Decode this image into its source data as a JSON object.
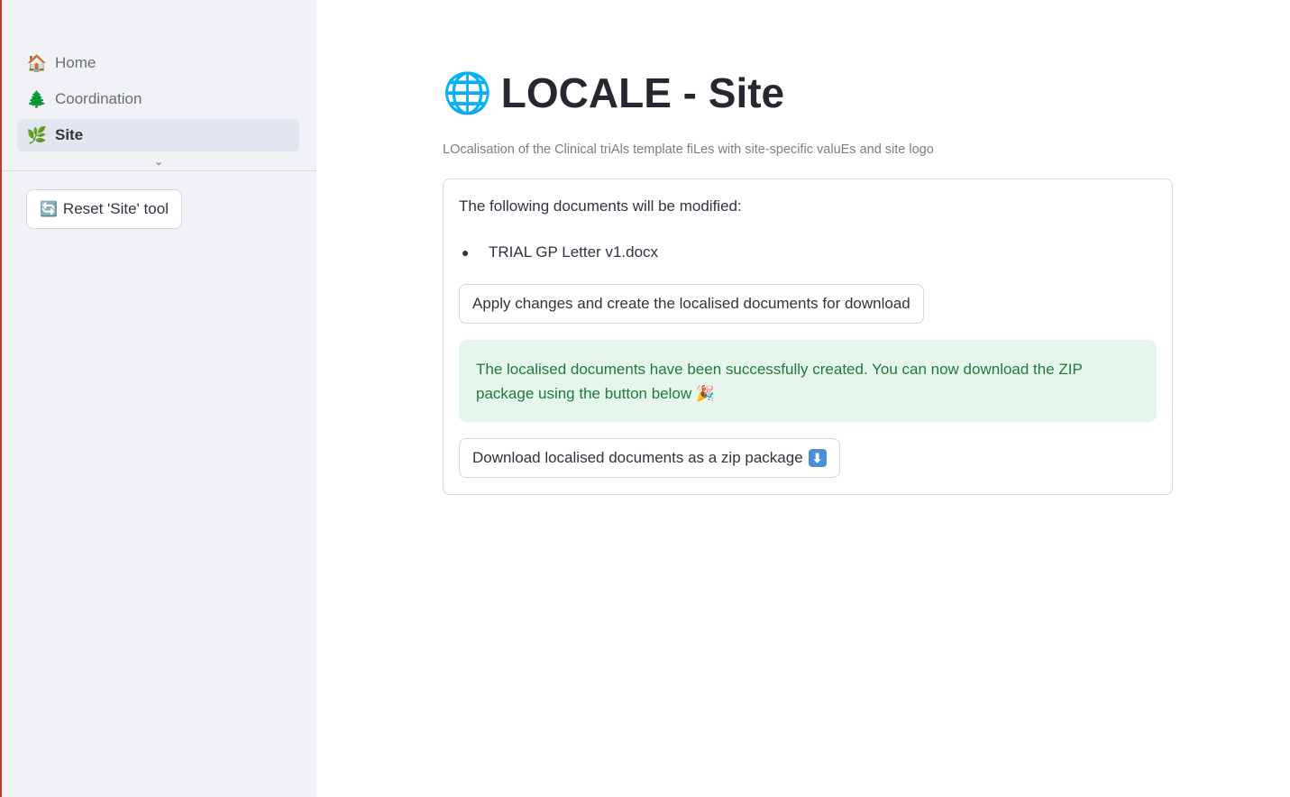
{
  "sidebar": {
    "nav": [
      {
        "icon": "🏠",
        "label": "Home",
        "active": false
      },
      {
        "icon": "🌲",
        "label": "Coordination",
        "active": false
      },
      {
        "icon": "🌿",
        "label": "Site",
        "active": true
      }
    ],
    "chevron_icon": "chevron-down-icon",
    "reset_button": {
      "icon": "🔄",
      "label": "Reset 'Site' tool"
    }
  },
  "main": {
    "title_icon": "🌐",
    "title": "LOCALE - Site",
    "subtitle": "LOcalisation of the Clinical triAls template fiLes with site-specific valuEs and site logo",
    "card": {
      "heading": "The following documents will be modified:",
      "documents": [
        "TRIAL GP Letter v1.docx"
      ],
      "apply_button": "Apply changes and create the localised documents for download",
      "success_message": "The localised documents have been successfully created. You can now download the ZIP package using the button below 🎉",
      "download_button": "Download localised documents as a zip package",
      "download_icon": "⬇"
    }
  },
  "colors": {
    "sidebar_bg": "#f0f2f6",
    "success_bg": "#e7f6ec",
    "success_text": "#1f7a3d",
    "left_edge": "#c0392b"
  }
}
